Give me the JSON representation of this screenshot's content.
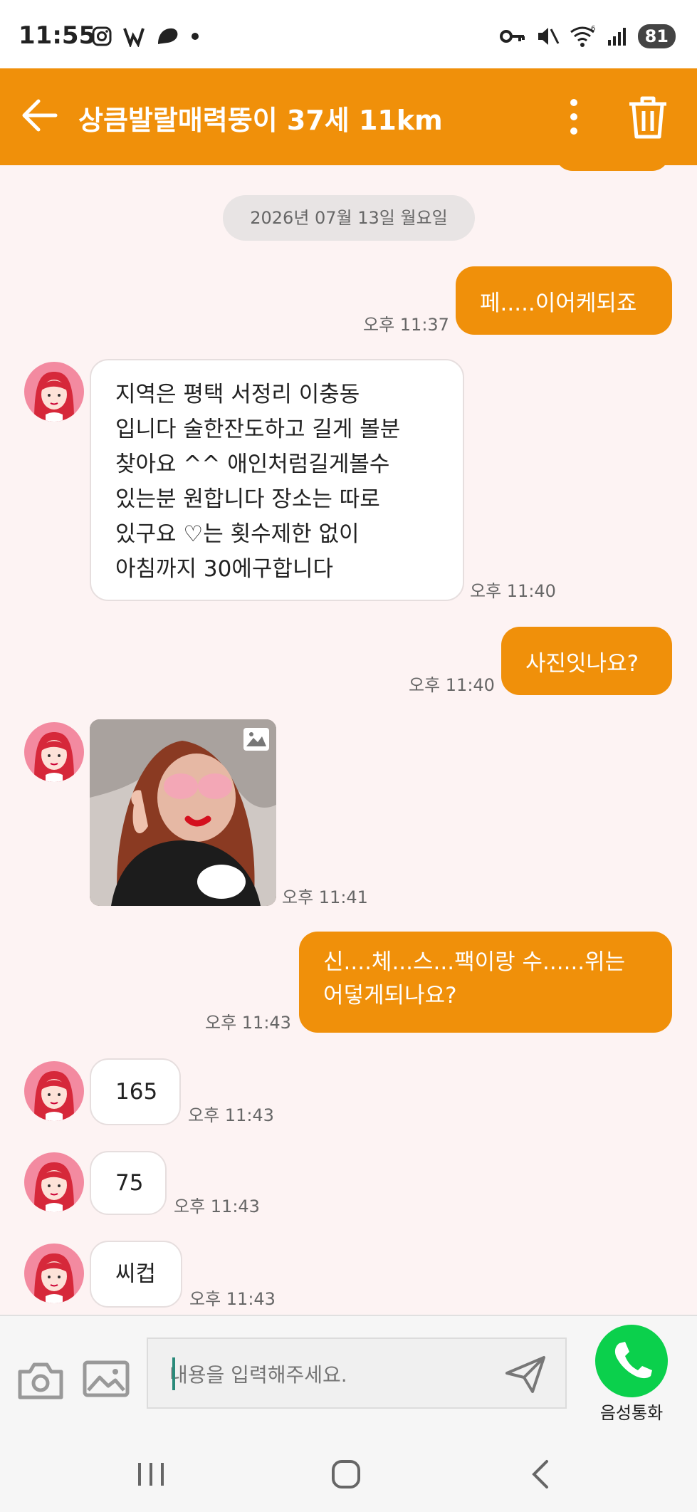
{
  "status_bar": {
    "time": "11:55",
    "battery": "81",
    "icons": [
      "instagram-icon",
      "app-icon",
      "chat-app-icon",
      "dot-icon",
      "key-icon",
      "mute-icon",
      "wifi-icon",
      "signal-icon"
    ]
  },
  "header": {
    "title": "상큼발랄매력뚱이 37세 11km",
    "accent_color": "#f0900a"
  },
  "chat": {
    "date": "2026년 07월 13일 월요일",
    "messages": [
      {
        "side": "out",
        "text": "페.....이어케되죠",
        "time": "오후 11:37"
      },
      {
        "side": "in",
        "text": "지역은 평택 서정리 이충동\n입니다 술한잔도하고 길게 볼분\n찾아요 ^^ 애인처럼길게볼수\n있는분 원합니다 장소는 따로\n있구요 ♡는 횟수제한 없이\n아침까지 30에구합니다",
        "time": "오후 11:40"
      },
      {
        "side": "out",
        "text": "사진잇나요?",
        "time": "오후 11:40"
      },
      {
        "side": "in",
        "type": "photo",
        "time": "오후 11:41"
      },
      {
        "side": "out",
        "text": "신....체...스...팩이랑 수......위는\n어덯게되나요?",
        "time": "오후 11:43"
      },
      {
        "side": "in",
        "text": "165",
        "time": "오후 11:43"
      },
      {
        "side": "in",
        "text": "75",
        "time": "오후 11:43"
      },
      {
        "side": "in",
        "text": "씨컵",
        "time": "오후 11:43"
      }
    ]
  },
  "input": {
    "placeholder": "내용을 입력해주세요.",
    "call_label": "음성통화"
  }
}
